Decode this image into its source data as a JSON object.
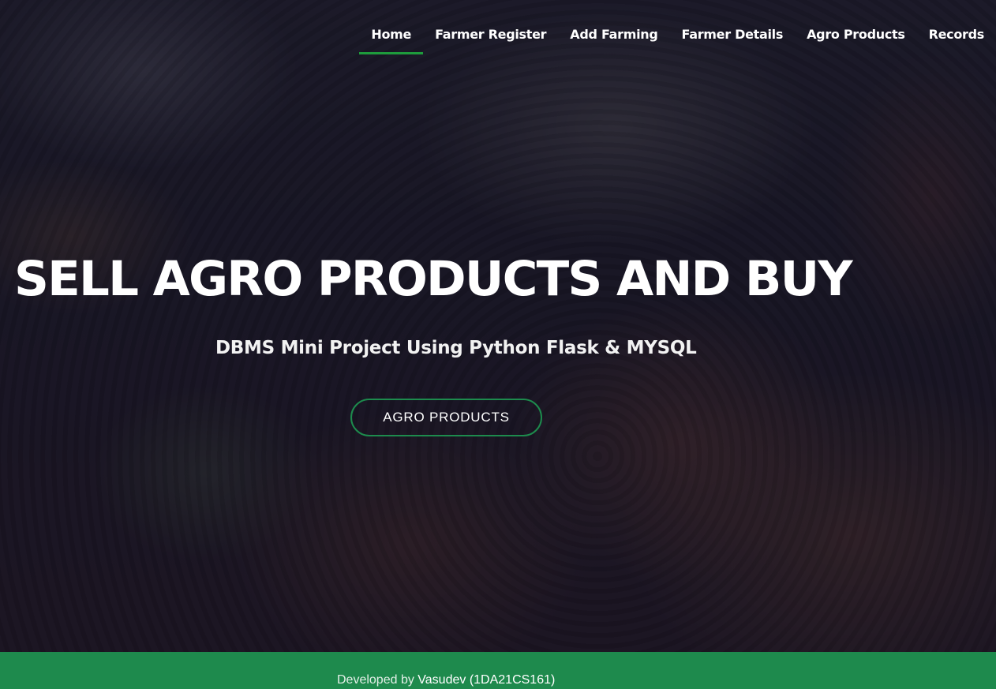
{
  "nav": {
    "items": [
      {
        "label": "Home",
        "active": true
      },
      {
        "label": "Farmer Register"
      },
      {
        "label": "Add Farming"
      },
      {
        "label": "Farmer Details"
      },
      {
        "label": "Agro Products"
      },
      {
        "label": "Records"
      }
    ]
  },
  "hero": {
    "title": "SELL AGRO PRODUCTS AND BUY",
    "subtitle": "DBMS Mini Project Using Python Flask & MYSQL",
    "button_label": "AGRO PRODUCTS"
  },
  "footer": {
    "prefix": "Developed by",
    "developer": "Vasudev (1DA21CS161)"
  },
  "colors": {
    "accent": "#1e8a4d",
    "nav_active_underline": "#1e9b3c"
  }
}
